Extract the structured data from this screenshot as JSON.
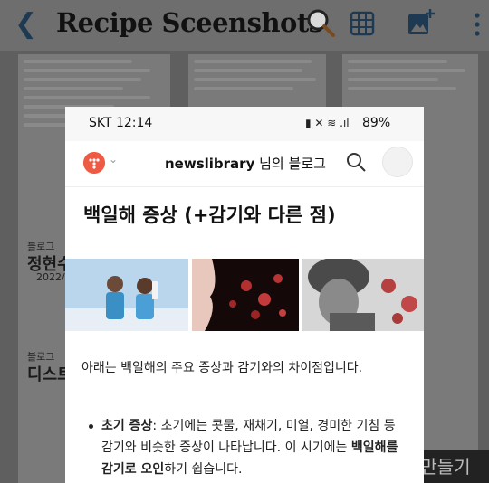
{
  "app": {
    "back_icon": "back-arrow-icon",
    "title": "Recipe Sceenshots",
    "actions": [
      "magnifier-icon",
      "grid-icon",
      "add-image-icon",
      "more-vert-icon"
    ],
    "bottom_button": "만들기"
  },
  "background_fragments": {
    "left_label_1": "블로그",
    "left_heading": "정현수",
    "left_date": "2022/0",
    "left_label_2": "블로그",
    "left_heading_2": "디스트"
  },
  "phone": {
    "status": {
      "time": "SKT 12:14",
      "icons": "▮ ✕ ≋ .ıl",
      "battery": "89%"
    },
    "nav": {
      "blog_name": "newslibrary",
      "blog_suffix": " 님의 블로그",
      "logo_icon": "tistory-logo-icon"
    },
    "post": {
      "title": "백일해 증상 (+감기와 다른 점)",
      "images": [
        "children-with-masks-image",
        "cough-virus-image",
        "man-coughing-image"
      ],
      "intro": "아래는 백일해의 주요 증상과 감기와의 차이점입니다.",
      "bullet": {
        "label": "초기 증상",
        "line1_rest": ": 초기에는 콧물, 재채기, 미열, 경미한 기침 등",
        "line2_plain": "감기와 비슷한 증상이 나타납니다. 이 시기에는 ",
        "line2_bold": "백일해를",
        "line3_bold": "감기로 오인",
        "line3_plain": "하기 쉽습니다."
      }
    }
  },
  "colors": {
    "overlay": "#5f5f5f",
    "logo": "#ee5a44",
    "title_text": "#111111"
  }
}
